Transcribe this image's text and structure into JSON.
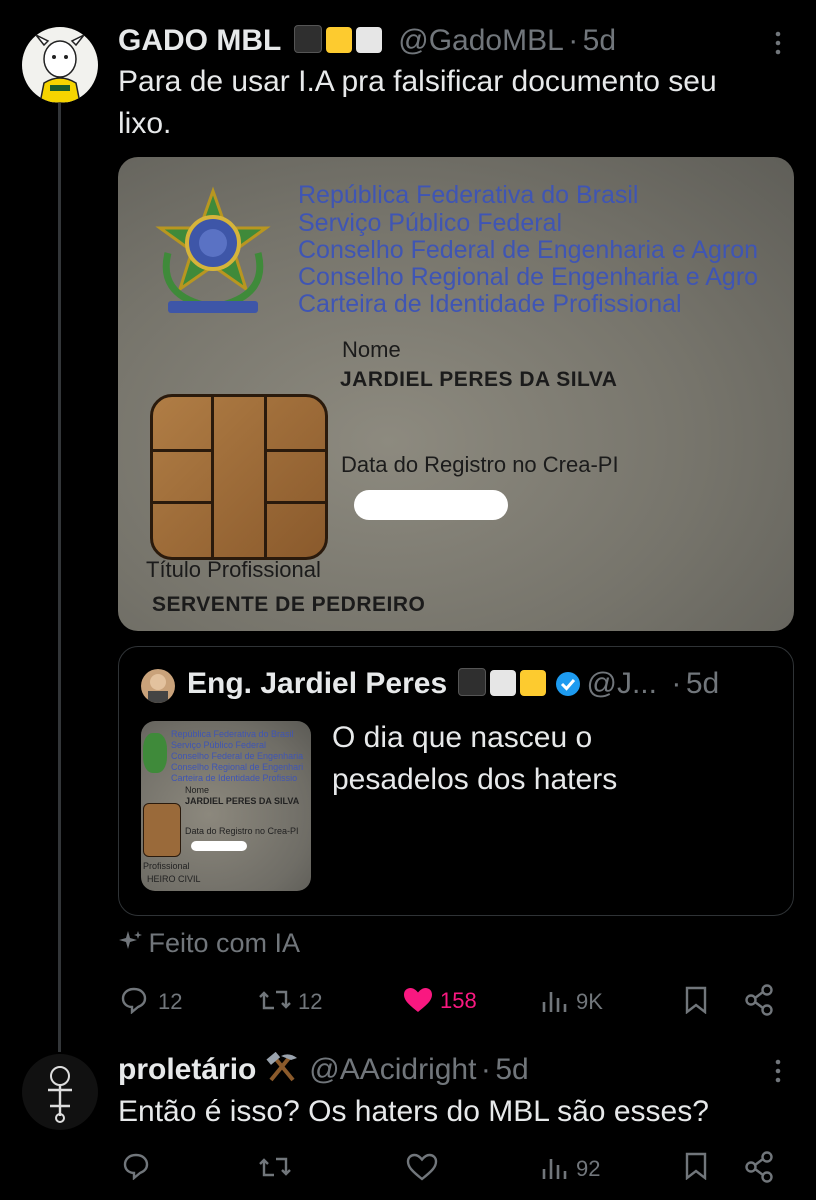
{
  "tweet": {
    "display_name": "GADO MBL",
    "badges_emoji": [
      "black-square",
      "yellow-square",
      "white-square"
    ],
    "handle": "@GadoMBL",
    "separator": "·",
    "time": "5d",
    "text_line1": "Para de usar I.A pra falsificar documento seu",
    "text_line2": "lixo.",
    "image": {
      "header_lines": [
        "República Federativa do Brasil",
        "Serviço Público Federal",
        "Conselho Federal de Engenharia e Agron",
        "Conselho Regional de Engenharia e Agro",
        "Carteira de Identidade Profissional"
      ],
      "nome_label": "Nome",
      "nome_value": "JARDIEL PERES DA SILVA",
      "registro_label": "Data do Registro no Crea-PI",
      "titulo_label": "Título Profissional",
      "titulo_value": "SERVENTE DE PEDREIRO"
    },
    "quote": {
      "display_name": "Eng. Jardiel Peres",
      "handle": "@J...",
      "separator": "·",
      "time": "5d",
      "text_line1": "O dia que nasceu o",
      "text_line2": "pesadelos dos haters",
      "thumb": {
        "header_lines": [
          "República Federativa do Brasil",
          "Serviço Público Federal",
          "Conselho Federal de Engenharia",
          "Conselho Regional de Engenhari",
          "Carteira de Identidade Profissio"
        ],
        "nome_label": "Nome",
        "nome_value": "JARDIEL PERES DA SILVA",
        "registro_label": "Data do Registro no Crea-PI",
        "titulo_label": "Profissional",
        "titulo_value": "HEIRO CIVIL"
      }
    },
    "ai_label": "Feito com IA",
    "ai_icon": "sparkle-icon",
    "stats": {
      "replies": "12",
      "retweets": "12",
      "likes": "158",
      "views": "9K"
    },
    "like_color": "#f91880"
  },
  "reply": {
    "display_name": "proletário",
    "name_emoji": "hammer-and-pick",
    "handle": "@AAcidright",
    "separator": "·",
    "time": "5d",
    "text": "Então é isso? Os haters do MBL são esses?",
    "stats": {
      "views": "92"
    }
  },
  "colors": {
    "background": "#000000",
    "text": "#e7e9ea",
    "muted": "#71767b",
    "verified": "#1d9bf0"
  }
}
